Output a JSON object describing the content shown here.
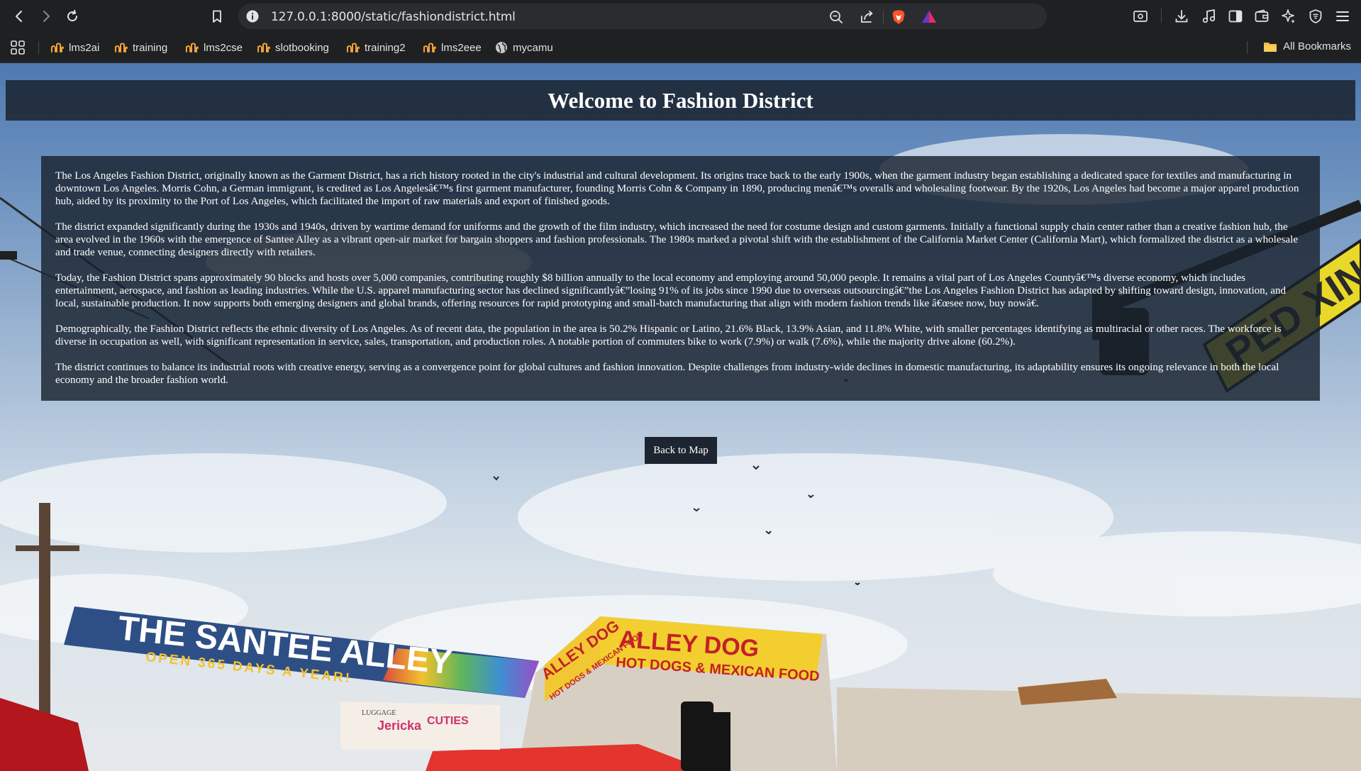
{
  "browser": {
    "url": "127.0.0.1:8000/static/fashiondistrict.html",
    "bookmarks": [
      {
        "label": "lms2ai",
        "icon": "hackerrank-icon"
      },
      {
        "label": "training",
        "icon": "hackerrank-icon"
      },
      {
        "label": "lms2cse",
        "icon": "hackerrank-icon"
      },
      {
        "label": "slotbooking",
        "icon": "hackerrank-icon"
      },
      {
        "label": "training2",
        "icon": "hackerrank-icon"
      },
      {
        "label": "lms2eee",
        "icon": "hackerrank-icon"
      },
      {
        "label": "mycamu",
        "icon": "globe-icon"
      }
    ],
    "all_bookmarks_label": "All Bookmarks"
  },
  "page": {
    "title": "Welcome to Fashion District",
    "paragraphs": [
      "The Los Angeles Fashion District, originally known as the Garment District, has a rich history rooted in the city's industrial and cultural development. Its origins trace back to the early 1900s, when the garment industry began establishing a dedicated space for textiles and manufacturing in downtown Los Angeles. Morris Cohn, a German immigrant, is credited as Los Angelesâ€™s first garment manufacturer, founding Morris Cohn & Company in 1890, producing menâ€™s overalls and wholesaling footwear. By the 1920s, Los Angeles had become a major apparel production hub, aided by its proximity to the Port of Los Angeles, which facilitated the import of raw materials and export of finished goods.",
      "The district expanded significantly during the 1930s and 1940s, driven by wartime demand for uniforms and the growth of the film industry, which increased the need for costume design and custom garments. Initially a functional supply chain center rather than a creative fashion hub, the area evolved in the 1960s with the emergence of Santee Alley as a vibrant open-air market for bargain shoppers and fashion professionals. The 1980s marked a pivotal shift with the establishment of the California Market Center (California Mart), which formalized the district as a wholesale and trade venue, connecting designers directly with retailers.",
      "Today, the Fashion District spans approximately 90 blocks and hosts over 5,000 companies, contributing roughly $8 billion annually to the local economy and employing around 50,000 people. It remains a vital part of Los Angeles Countyâ€™s diverse economy, which includes entertainment, aerospace, and fashion as leading industries. While the U.S. apparel manufacturing sector has declined significantlyâ€”losing 91% of its jobs since 1990 due to overseas outsourcingâ€”the Los Angeles Fashion District has adapted by shifting toward design, innovation, and local, sustainable production. It now supports both emerging designers and global brands, offering resources for rapid prototyping and small-batch manufacturing that align with modern fashion trends like â€œsee now, buy nowâ€.",
      "Demographically, the Fashion District reflects the ethnic diversity of Los Angeles. As of recent data, the population in the area is 50.2% Hispanic or Latino, 21.6% Black, 13.9% Asian, and 11.8% White, with smaller percentages identifying as multiracial or other races. The workforce is diverse in occupation as well, with significant representation in service, sales, transportation, and production roles. A notable portion of commuters bike to work (7.9%) or walk (7.6%), while the majority drive alone (60.2%).",
      "The district continues to balance its industrial roots with creative energy, serving as a convergence point for global cultures and fashion innovation. Despite challenges from industry-wide declines in domestic manufacturing, its adaptability ensures its ongoing relevance in both the local economy and the broader fashion world."
    ],
    "back_button_label": "Back to Map"
  },
  "background": {
    "banner_text": "THE SANTEE ALLEY",
    "banner_subtext": "OPEN 365 DAYS A YEAR!",
    "sign_text": "ALLEY DOG",
    "sign_subtext": "HOT DOGS & MEXICAN FOOD",
    "side_sign_text": "ALLEY DOG",
    "side_sign_subtext": "HOT DOGS & MEXICAN FOOD",
    "street_sign_text": "PED XING",
    "store_sign_text": "Jericka",
    "store_sign_text2": "CUTIES",
    "store_sign_small": "LUGGAGE"
  },
  "colors": {
    "chrome": "#1f2022",
    "omnibox": "#2b2c30",
    "panel": "#19222e",
    "banner": "#2e4f86"
  }
}
